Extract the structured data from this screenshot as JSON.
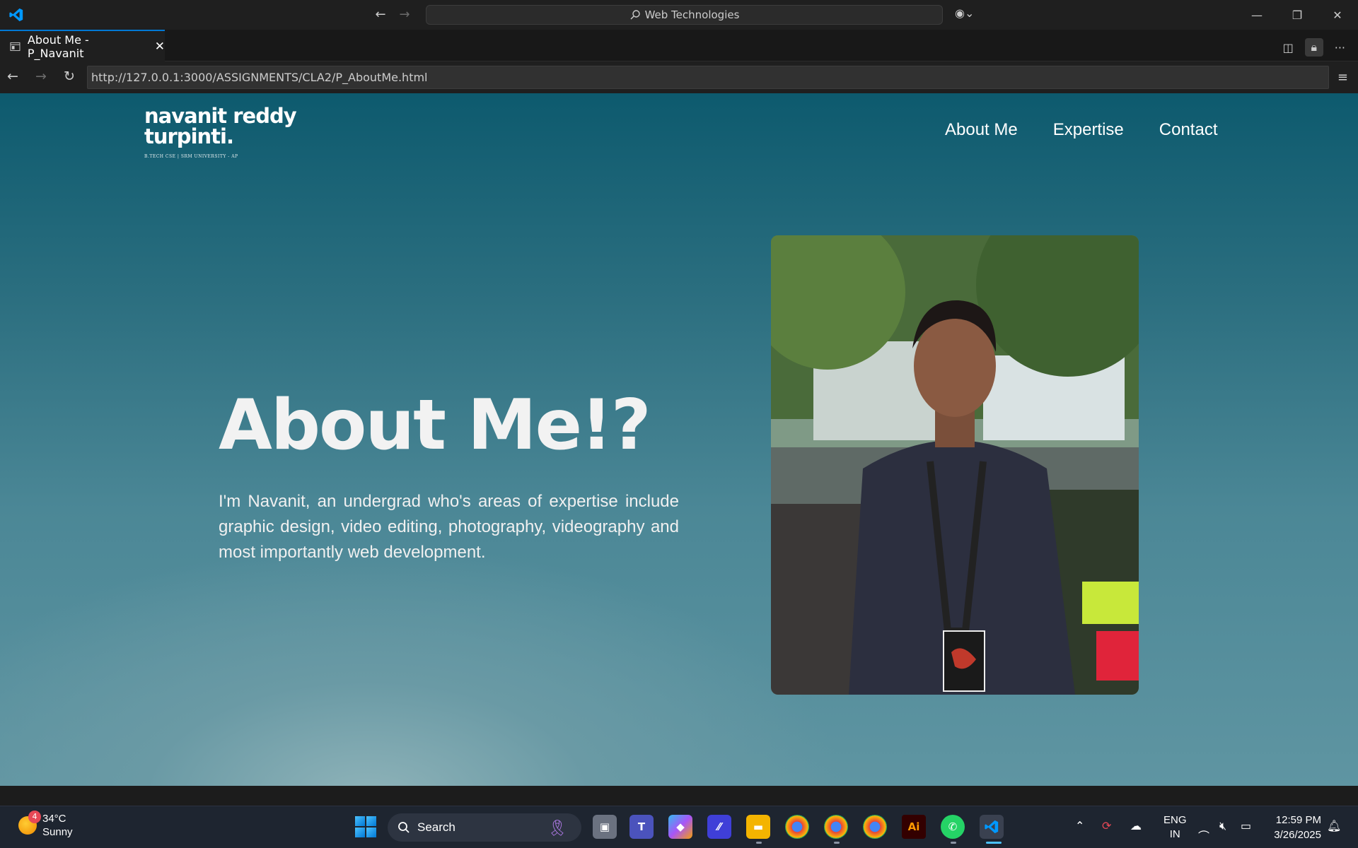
{
  "titlebar": {
    "search_text": "Web Technologies"
  },
  "tab": {
    "title": "About Me - P_Navanit",
    "close": "✕"
  },
  "address": {
    "url": "http://127.0.0.1:3000/ASSIGNMENTS/CLA2/P_AboutMe.html"
  },
  "site": {
    "logo_line1": "navanit reddy",
    "logo_line2": "turpinti.",
    "logo_sub": "B.TECH CSE | SRM UNIVERSITY - AP",
    "nav": [
      "About Me",
      "Expertise",
      "Contact"
    ],
    "hero_title": "About Me!?",
    "hero_text": "I'm Navanit, an undergrad who's areas of expertise include graphic design, video editing, photography, videography and most importantly web development."
  },
  "taskbar": {
    "temperature": "34°C",
    "weather": "Sunny",
    "weather_badge": "4",
    "search_label": "Search",
    "lang_line1": "ENG",
    "lang_line2": "IN",
    "time": "12:59 PM",
    "date": "3/26/2025"
  },
  "colors": {
    "accent": "#0078d4",
    "titlebar_bg": "#1f1f1f",
    "page_top": "#0d5a6e",
    "page_bottom": "#8fb3b9"
  },
  "icons": [
    "vscode-logo-icon",
    "back-arrow-icon",
    "forward-arrow-icon",
    "search-icon",
    "copilot-icon",
    "minimize-icon",
    "restore-icon",
    "close-icon",
    "preview-tab-icon",
    "split-editor-icon",
    "lock-icon",
    "more-icon",
    "reload-icon",
    "menu-icon",
    "windows-start-icon",
    "task-view-icon",
    "teams-icon",
    "copilot-app-icon",
    "file-explorer-icon",
    "chrome-icon",
    "illustrator-icon",
    "whatsapp-icon",
    "vscode-taskbar-icon",
    "chevron-up-icon",
    "sync-icon",
    "onedrive-icon",
    "wifi-icon",
    "volume-muted-icon",
    "battery-icon",
    "notification-icon"
  ]
}
